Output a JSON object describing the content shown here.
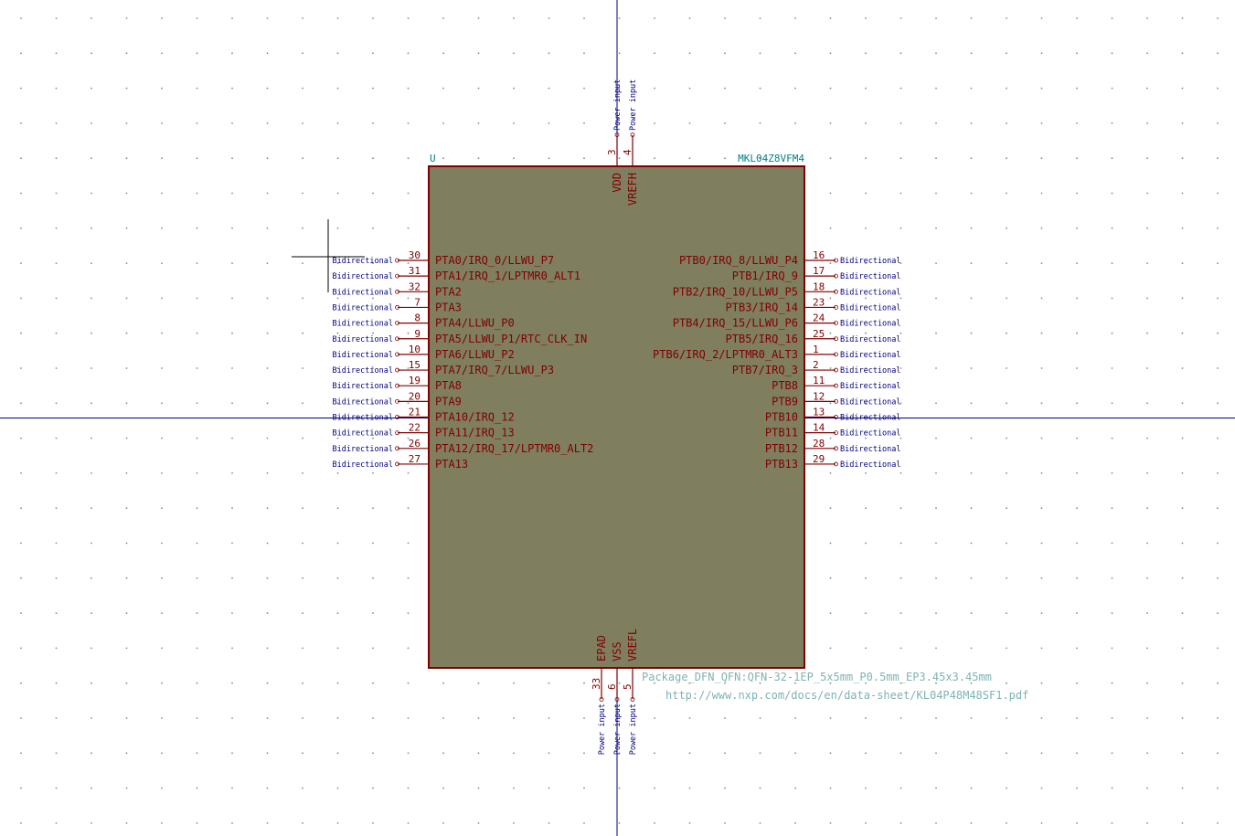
{
  "component": {
    "reference": "U",
    "value": "MKL04Z8VFM4",
    "footprint": "Package_DFN_QFN:QFN-32-1EP_5x5mm_P0.5mm_EP3.45x3.45mm",
    "datasheet": "http://www.nxp.com/docs/en/data-sheet/KL04P48M48SF1.pdf"
  },
  "colors": {
    "body_fill": "#7f7f5f",
    "body_outline": "#800000",
    "pin_line": "#800000",
    "pin_text": "#800000",
    "etype_text": "#000080",
    "axis": "#000080",
    "grid_dot": "#8a8a8a"
  },
  "left_pins": [
    {
      "num": "30",
      "name": "PTA0/IRQ_0/LLWU_P7",
      "type": "Bidirectional"
    },
    {
      "num": "31",
      "name": "PTA1/IRQ_1/LPTMR0_ALT1",
      "type": "Bidirectional"
    },
    {
      "num": "32",
      "name": "PTA2",
      "type": "Bidirectional"
    },
    {
      "num": "7",
      "name": "PTA3",
      "type": "Bidirectional"
    },
    {
      "num": "8",
      "name": "PTA4/LLWU_P0",
      "type": "Bidirectional"
    },
    {
      "num": "9",
      "name": "PTA5/LLWU_P1/RTC_CLK_IN",
      "type": "Bidirectional"
    },
    {
      "num": "10",
      "name": "PTA6/LLWU_P2",
      "type": "Bidirectional"
    },
    {
      "num": "15",
      "name": "PTA7/IRQ_7/LLWU_P3",
      "type": "Bidirectional"
    },
    {
      "num": "19",
      "name": "PTA8",
      "type": "Bidirectional"
    },
    {
      "num": "20",
      "name": "PTA9",
      "type": "Bidirectional"
    },
    {
      "num": "21",
      "name": "PTA10/IRQ_12",
      "type": "Bidirectional"
    },
    {
      "num": "22",
      "name": "PTA11/IRQ_13",
      "type": "Bidirectional"
    },
    {
      "num": "26",
      "name": "PTA12/IRQ_17/LPTMR0_ALT2",
      "type": "Bidirectional"
    },
    {
      "num": "27",
      "name": "PTA13",
      "type": "Bidirectional"
    }
  ],
  "right_pins": [
    {
      "num": "16",
      "name": "PTB0/IRQ_8/LLWU_P4",
      "type": "Bidirectional"
    },
    {
      "num": "17",
      "name": "PTB1/IRQ_9",
      "type": "Bidirectional"
    },
    {
      "num": "18",
      "name": "PTB2/IRQ_10/LLWU_P5",
      "type": "Bidirectional"
    },
    {
      "num": "23",
      "name": "PTB3/IRQ_14",
      "type": "Bidirectional"
    },
    {
      "num": "24",
      "name": "PTB4/IRQ_15/LLWU_P6",
      "type": "Bidirectional"
    },
    {
      "num": "25",
      "name": "PTB5/IRQ_16",
      "type": "Bidirectional"
    },
    {
      "num": "1",
      "name": "PTB6/IRQ_2/LPTMR0_ALT3",
      "type": "Bidirectional"
    },
    {
      "num": "2",
      "name": "PTB7/IRQ_3",
      "type": "Bidirectional"
    },
    {
      "num": "11",
      "name": "PTB8",
      "type": "Bidirectional"
    },
    {
      "num": "12",
      "name": "PTB9",
      "type": "Bidirectional"
    },
    {
      "num": "13",
      "name": "PTB10",
      "type": "Bidirectional"
    },
    {
      "num": "14",
      "name": "PTB11",
      "type": "Bidirectional"
    },
    {
      "num": "28",
      "name": "PTB12",
      "type": "Bidirectional"
    },
    {
      "num": "29",
      "name": "PTB13",
      "type": "Bidirectional"
    }
  ],
  "top_pins": [
    {
      "num": "3",
      "name": "VDD",
      "type": "Power input"
    },
    {
      "num": "4",
      "name": "VREFH",
      "type": "Power input"
    }
  ],
  "bottom_pins": [
    {
      "num": "33",
      "name": "EPAD",
      "type": "Power input"
    },
    {
      "num": "6",
      "name": "VSS",
      "type": "Power input"
    },
    {
      "num": "5",
      "name": "VREFL",
      "type": "Power input"
    }
  ]
}
